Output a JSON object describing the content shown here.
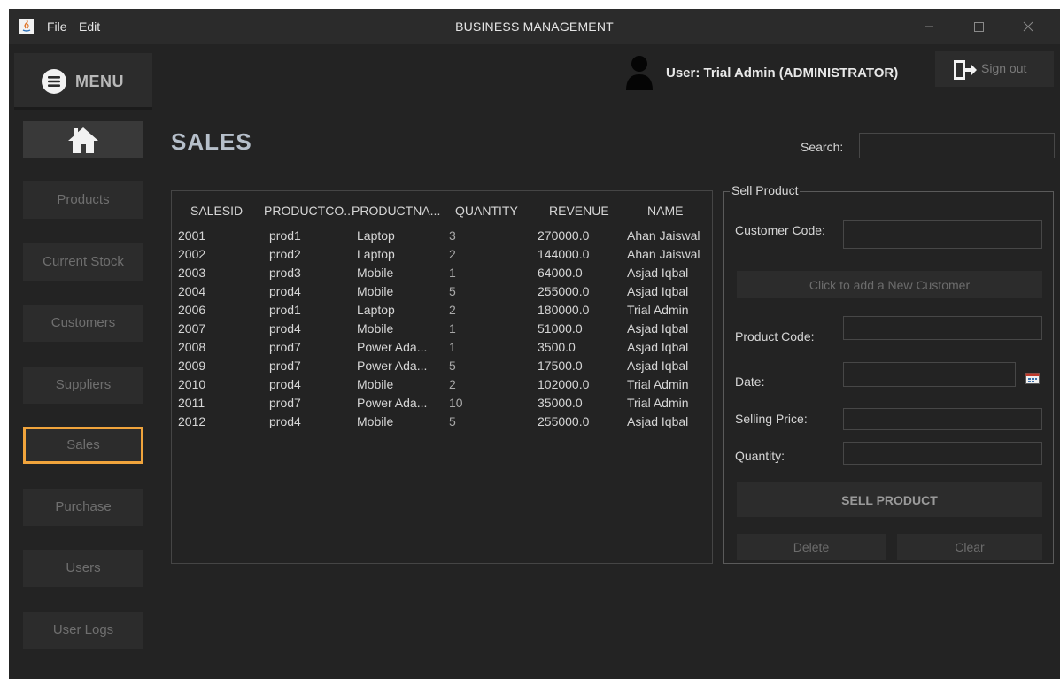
{
  "window": {
    "title": "BUSINESS MANAGEMENT",
    "menu": [
      "File",
      "Edit"
    ]
  },
  "sidebar": {
    "menu_label": "MENU",
    "items": [
      {
        "label": "Products",
        "active": false
      },
      {
        "label": "Current Stock",
        "active": false
      },
      {
        "label": "Customers",
        "active": false
      },
      {
        "label": "Suppliers",
        "active": false
      },
      {
        "label": "Sales",
        "active": true
      },
      {
        "label": "Purchase",
        "active": false
      },
      {
        "label": "Users",
        "active": false
      },
      {
        "label": "User Logs",
        "active": false
      }
    ]
  },
  "header": {
    "user_label": "User: Trial Admin (ADMINISTRATOR)",
    "signout_label": "Sign out"
  },
  "page": {
    "title": "SALES",
    "search_label": "Search:",
    "search_value": ""
  },
  "table": {
    "columns": [
      "SALESID",
      "PRODUCTCO...",
      "PRODUCTNA...",
      "QUANTITY",
      "REVENUE",
      "NAME"
    ],
    "rows": [
      [
        "2001",
        "prod1",
        "Laptop",
        "3",
        "270000.0",
        "Ahan Jaiswal"
      ],
      [
        "2002",
        "prod2",
        "Laptop",
        "2",
        "144000.0",
        "Ahan Jaiswal"
      ],
      [
        "2003",
        "prod3",
        "Mobile",
        "1",
        "64000.0",
        "Asjad Iqbal"
      ],
      [
        "2004",
        "prod4",
        "Mobile",
        "5",
        "255000.0",
        "Asjad Iqbal"
      ],
      [
        "2006",
        "prod1",
        "Laptop",
        "2",
        "180000.0",
        "Trial Admin"
      ],
      [
        "2007",
        "prod4",
        "Mobile",
        "1",
        "51000.0",
        "Asjad Iqbal"
      ],
      [
        "2008",
        "prod7",
        "Power Ada...",
        "1",
        "3500.0",
        "Asjad Iqbal"
      ],
      [
        "2009",
        "prod7",
        "Power Ada...",
        "5",
        "17500.0",
        "Asjad Iqbal"
      ],
      [
        "2010",
        "prod4",
        "Mobile",
        "2",
        "102000.0",
        "Trial Admin"
      ],
      [
        "2011",
        "prod7",
        "Power Ada...",
        "10",
        "35000.0",
        "Trial Admin"
      ],
      [
        "2012",
        "prod4",
        "Mobile",
        "5",
        "255000.0",
        "Asjad Iqbal"
      ]
    ]
  },
  "sell_panel": {
    "title": "Sell Product",
    "customer_code_label": "Customer Code:",
    "customer_code_value": "",
    "add_customer_label": "Click to add a New Customer",
    "product_code_label": "Product Code:",
    "product_code_value": "",
    "date_label": "Date:",
    "date_value": "",
    "selling_price_label": "Selling Price:",
    "selling_price_value": "",
    "quantity_label": "Quantity:",
    "quantity_value": "",
    "sell_button_label": "SELL PRODUCT",
    "delete_label": "Delete",
    "clear_label": "Clear"
  },
  "colors": {
    "background": "#232323",
    "title_bar": "#2b2b2b",
    "button": "#2c2c2c",
    "active_border": "#f0a43c",
    "page_title": "#b6bfca"
  }
}
